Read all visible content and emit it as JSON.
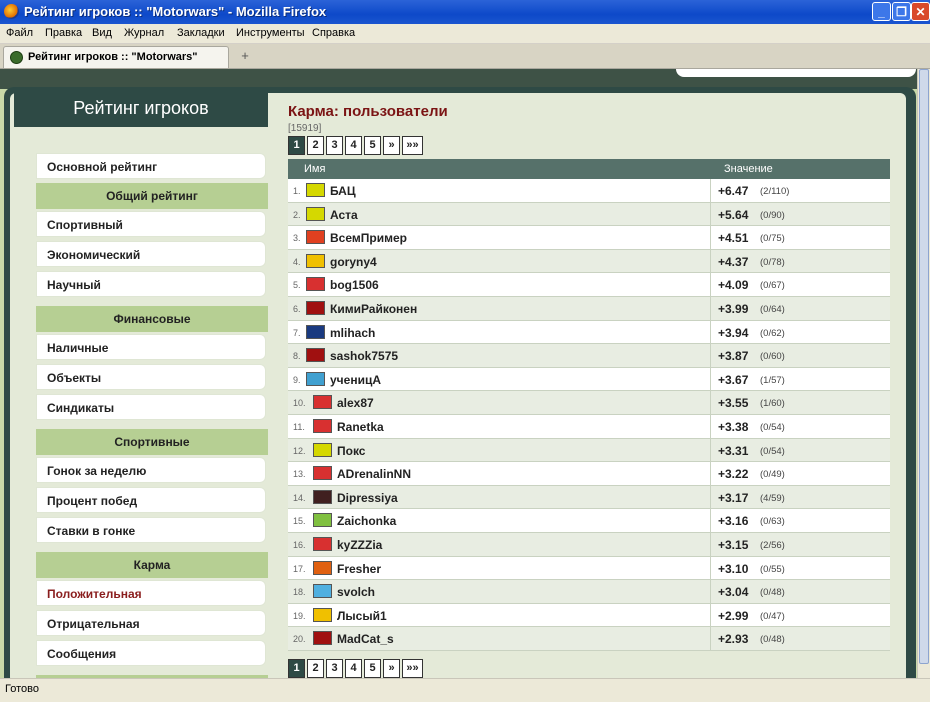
{
  "window": {
    "title": "Рейтинг игроков :: \"Motorwars\" - Mozilla Firefox",
    "buttons": {
      "minimize": "_",
      "restore": "❐",
      "close": "✕"
    }
  },
  "menu": [
    "Файл",
    "Правка",
    "Вид",
    "Журнал",
    "Закладки",
    "Инструменты",
    "Справка"
  ],
  "tab": {
    "title": "Рейтинг игроков :: \"Motorwars\"",
    "new_tab": "+"
  },
  "sidebar": {
    "title": "Рейтинг игроков",
    "items": [
      {
        "label": "Основной рейтинг",
        "type": "link"
      },
      {
        "label": "Общий рейтинг",
        "type": "group"
      },
      {
        "label": "Спортивный",
        "type": "link"
      },
      {
        "label": "Экономический",
        "type": "link"
      },
      {
        "label": "Научный",
        "type": "link"
      },
      {
        "label": "Финансовые",
        "type": "group"
      },
      {
        "label": "Наличные",
        "type": "link"
      },
      {
        "label": "Объекты",
        "type": "link"
      },
      {
        "label": "Синдикаты",
        "type": "link"
      },
      {
        "label": "Спортивные",
        "type": "group"
      },
      {
        "label": "Гонок за неделю",
        "type": "link"
      },
      {
        "label": "Процент побед",
        "type": "link"
      },
      {
        "label": "Ставки в гонке",
        "type": "link"
      },
      {
        "label": "Карма",
        "type": "group"
      },
      {
        "label": "Положительная",
        "type": "link",
        "active": true
      },
      {
        "label": "Отрицательная",
        "type": "link"
      },
      {
        "label": "Сообщения",
        "type": "link"
      }
    ]
  },
  "main": {
    "heading": "Карма: пользователи",
    "total": "[15919]",
    "pager": [
      "1",
      "2",
      "3",
      "4",
      "5",
      "»",
      "»»"
    ],
    "current_page": "1",
    "columns": {
      "name": "Имя",
      "value": "Значение"
    },
    "rows": [
      {
        "rank": "1.",
        "name": "БАЦ",
        "score": "+6.47",
        "votes": "(2/110)",
        "avatar_color": "#d5d800"
      },
      {
        "rank": "2.",
        "name": "Аста",
        "score": "+5.64",
        "votes": "(0/90)",
        "avatar_color": "#d5d800"
      },
      {
        "rank": "3.",
        "name": "ВсемПример",
        "score": "+4.51",
        "votes": "(0/75)",
        "avatar_color": "#e04020"
      },
      {
        "rank": "4.",
        "name": "goryny4",
        "score": "+4.37",
        "votes": "(0/78)",
        "avatar_color": "#f0c000"
      },
      {
        "rank": "5.",
        "name": "bog1506",
        "score": "+4.09",
        "votes": "(0/67)",
        "avatar_color": "#d83030"
      },
      {
        "rank": "6.",
        "name": "КимиРайконен",
        "score": "+3.99",
        "votes": "(0/64)",
        "avatar_color": "#a01010"
      },
      {
        "rank": "7.",
        "name": "mlihach",
        "score": "+3.94",
        "votes": "(0/62)",
        "avatar_color": "#1a3a80"
      },
      {
        "rank": "8.",
        "name": "sashok7575",
        "score": "+3.87",
        "votes": "(0/60)",
        "avatar_color": "#a01010"
      },
      {
        "rank": "9.",
        "name": "ученицА",
        "score": "+3.67",
        "votes": "(1/57)",
        "avatar_color": "#40a0d0"
      },
      {
        "rank": "10.",
        "name": "alex87",
        "score": "+3.55",
        "votes": "(1/60)",
        "avatar_color": "#d83030"
      },
      {
        "rank": "11.",
        "name": "Ranetka",
        "score": "+3.38",
        "votes": "(0/54)",
        "avatar_color": "#d83030"
      },
      {
        "rank": "12.",
        "name": "Покс",
        "score": "+3.31",
        "votes": "(0/54)",
        "avatar_color": "#d5d800"
      },
      {
        "rank": "13.",
        "name": "ADrenalinNN",
        "score": "+3.22",
        "votes": "(0/49)",
        "avatar_color": "#d83030"
      },
      {
        "rank": "14.",
        "name": "Dipressiya",
        "score": "+3.17",
        "votes": "(4/59)",
        "avatar_color": "#402020"
      },
      {
        "rank": "15.",
        "name": "Zaichonka",
        "score": "+3.16",
        "votes": "(0/63)",
        "avatar_color": "#80c040"
      },
      {
        "rank": "16.",
        "name": "kyZZZia",
        "score": "+3.15",
        "votes": "(2/56)",
        "avatar_color": "#d83030"
      },
      {
        "rank": "17.",
        "name": "Fresher",
        "score": "+3.10",
        "votes": "(0/55)",
        "avatar_color": "#e06010"
      },
      {
        "rank": "18.",
        "name": "svolch",
        "score": "+3.04",
        "votes": "(0/48)",
        "avatar_color": "#50b0e0"
      },
      {
        "rank": "19.",
        "name": "Лысый1",
        "score": "+2.99",
        "votes": "(0/47)",
        "avatar_color": "#f0c000"
      },
      {
        "rank": "20.",
        "name": "MadCat_s",
        "score": "+2.93",
        "votes": "(0/48)",
        "avatar_color": "#a01010"
      }
    ]
  },
  "status": "Готово"
}
